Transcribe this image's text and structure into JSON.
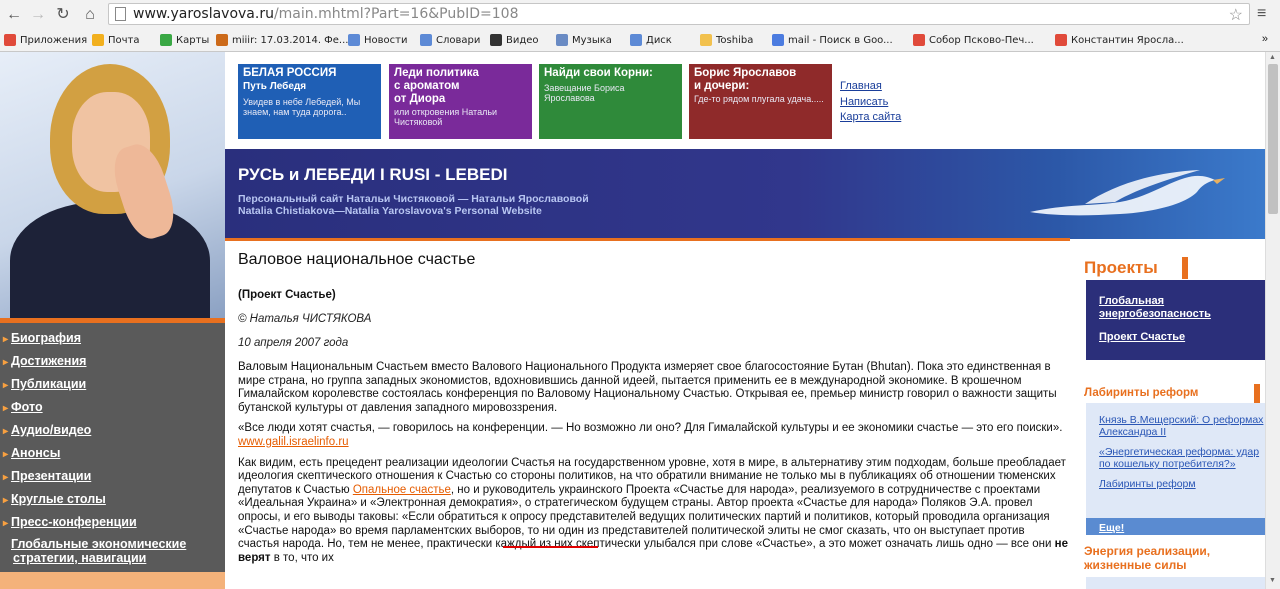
{
  "browser": {
    "url_host": "www.yaroslavova.ru",
    "url_path": "/main.mhtml?Part=16&PubID=108",
    "bookmarks": [
      {
        "label": "Приложения",
        "color": "#e04a3a"
      },
      {
        "label": "Почта",
        "color": "#f2b01e"
      },
      {
        "label": "Карты",
        "color": "#3aa845"
      },
      {
        "label": "miiir: 17.03.2014. Фе...",
        "color": "#cc6a1a"
      },
      {
        "label": "Новости",
        "color": "#5d8ad6"
      },
      {
        "label": "Словари",
        "color": "#5d8ad6"
      },
      {
        "label": "Видео",
        "color": "#333333"
      },
      {
        "label": "Музыка",
        "color": "#6a8bc4"
      },
      {
        "label": "Диск",
        "color": "#5d8ad6"
      },
      {
        "label": "Toshiba",
        "color": "#f2c14e"
      },
      {
        "label": "mail - Поиск в Goo...",
        "color": "#4c7ce0"
      },
      {
        "label": "Собор Псково-Печ...",
        "color": "#e04a3a"
      },
      {
        "label": "Константин Яросла...",
        "color": "#e04a3a"
      }
    ],
    "overflow": "»"
  },
  "banner": {
    "boxes": [
      {
        "title": "БЕЛАЯ РОССИЯ",
        "title2": "Путь Лебедя",
        "text": "Увидев в небе Лебедей, Мы знаем, нам туда дорога..",
        "color": "#1f5fb5"
      },
      {
        "title": "Леди  политика",
        "title2": "с  ароматом",
        "title3": "от Диора",
        "text": "или  откровения  Натальи Чистяковой",
        "color": "#7a2a9a"
      },
      {
        "title": "Найди свои Корни:",
        "text": "Завещание Бориса Ярославова",
        "color": "#2f8a3a"
      },
      {
        "title": "Борис Ярославов",
        "title2": "и дочери:",
        "text": "Где-то рядом плугала удача.....",
        "color": "#8f2a2a"
      }
    ],
    "links": [
      "Главная",
      "Написать",
      "Карта сайта"
    ],
    "site_title": "РУСЬ и ЛЕБЕДИ  I  RUSI - LEBEDI",
    "subtitle_ru": "Персональный сайт Натальи Чистяковой — Натальи Ярославовой",
    "subtitle_en": "Natalia Chistiakova—Natalia Yaroslavova's  Personal Website"
  },
  "left_nav": [
    "Биография",
    "Достижения",
    "Публикации",
    "Фото",
    "Аудио/видео",
    "Анонсы",
    "Презентации",
    "Круглые столы",
    "Пресс-конференции",
    "Глобальные экономические стратегии, навигации"
  ],
  "article": {
    "title": "Валовое национальное счастье",
    "project": "(Проект Счастье)",
    "author": "© Наталья ЧИСТЯКОВА",
    "date": "10 апреля 2007 года",
    "p1": "Валовым Национальным Счастьем вместо Валового Национального Продукта измеряет свое благосостояние Бутан (Bhutan). Пока это единственная в мире страна, но группа западных экономистов, вдохновившись данной идеей, пытается применить ее в международной экономике. В крошечном Гималайском королевстве состоялась конференция по Валовому Национальному Счастью. Открывая ее, премьер министр говорил о важности защиты бутанской культуры от давления западного мировоззрения.",
    "p2": "«Все люди хотят счастья, — говорилось на конференции. — Но возможно ли оно? Для Гималайской культуры и ее экономики счастье — это его поиски».",
    "p2_link": "www.galil.israelinfo.ru",
    "p3_a": "Как видим, есть прецедент реализации идеологии Счастья на государственном уровне, хотя в мире, в альтернативу этим подходам, больше преобладает идеология скептического отношения к Счастью со стороны политиков, на что обратили внимание не только мы в публикациях об отношении тюменских депутатов к Счастью ",
    "p3_link": "Опальное счастье",
    "p3_b": ", но и руководитель украинского Проекта «Счастье для народа», реализуемого в сотрудничестве с проектами «Идеальная Украина» и «Электронная демократия», о стратегическом будущем страны. Автор проекта «Счастье для народа» Поляков Э.А. провел опросы, и его выводы таковы: «Если обратиться к опросу представителей ведущих политических партий и политиков, который проводила организация «Счастье народа» во время парламентских выборов, то ни один из представителей политической элиты не смог сказать, что он выступает против счастья народа. Но, тем не менее, практически каждый из них скептически улыбался при слове «Счастье», а это может означать лишь одно — все они ",
    "p3_bold": "не верят",
    "p3_c": " в то, что их"
  },
  "sidebar": {
    "projects_title": "Проекты",
    "projects": [
      "Глобальная энергобезопасность",
      "Проект Счастье"
    ],
    "lab_title": "Лабиринты реформ",
    "lab_links": [
      "Князь В.Мещерский: О реформах Александра II",
      "«Энергетическая реформа: удар по кошельку потребителя?»",
      "Лабиринты реформ"
    ],
    "more": "Еще!",
    "energy_title": "Энергия реализации, жизненные силы"
  }
}
